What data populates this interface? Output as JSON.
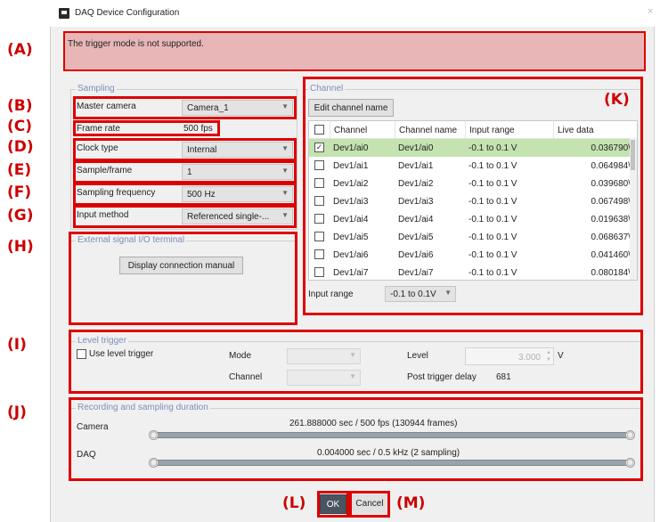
{
  "window": {
    "title": "DAQ Device Configuration",
    "close_glyph": "×"
  },
  "message": {
    "text": "The trigger mode is not supported."
  },
  "annotations": {
    "A": "(A)",
    "B": "(B)",
    "C": "(C)",
    "D": "(D)",
    "E": "(E)",
    "F": "(F)",
    "G": "(G)",
    "H": "(H)",
    "I": "(I)",
    "J": "(J)",
    "K": "(K)",
    "L": "(L)",
    "M": "(M)"
  },
  "sampling": {
    "group_title": "Sampling",
    "master_camera": {
      "label": "Master camera",
      "value": "Camera_1"
    },
    "frame_rate": {
      "label": "Frame rate",
      "value": "500 fps"
    },
    "clock_type": {
      "label": "Clock type",
      "value": "Internal"
    },
    "sample_frame": {
      "label": "Sample/frame",
      "value": "1"
    },
    "sampling_frequency": {
      "label": "Sampling frequency",
      "value": "500 Hz"
    },
    "input_method": {
      "label": "Input method",
      "value": "Referenced single-..."
    }
  },
  "external": {
    "group_title": "External signal I/O terminal",
    "button_label": "Display connection manual"
  },
  "channel": {
    "group_title": "Channel",
    "edit_button": "Edit channel name",
    "headers": [
      "Channel",
      "Channel name",
      "Input range",
      "Live data"
    ],
    "rows": [
      {
        "checked": true,
        "channel": "Dev1/ai0",
        "name": "Dev1/ai0",
        "range": "-0.1 to 0.1 V",
        "live": "0.036790\\"
      },
      {
        "checked": false,
        "channel": "Dev1/ai1",
        "name": "Dev1/ai1",
        "range": "-0.1 to 0.1 V",
        "live": "0.064984\\"
      },
      {
        "checked": false,
        "channel": "Dev1/ai2",
        "name": "Dev1/ai2",
        "range": "-0.1 to 0.1 V",
        "live": "0.039680\\"
      },
      {
        "checked": false,
        "channel": "Dev1/ai3",
        "name": "Dev1/ai3",
        "range": "-0.1 to 0.1 V",
        "live": "0.067498\\"
      },
      {
        "checked": false,
        "channel": "Dev1/ai4",
        "name": "Dev1/ai4",
        "range": "-0.1 to 0.1 V",
        "live": "0.019638\\"
      },
      {
        "checked": false,
        "channel": "Dev1/ai5",
        "name": "Dev1/ai5",
        "range": "-0.1 to 0.1 V",
        "live": "0.068637\\"
      },
      {
        "checked": false,
        "channel": "Dev1/ai6",
        "name": "Dev1/ai6",
        "range": "-0.1 to 0.1 V",
        "live": "0.041460\\"
      },
      {
        "checked": false,
        "channel": "Dev1/ai7",
        "name": "Dev1/ai7",
        "range": "-0.1 to 0.1 V",
        "live": "0.080184\\"
      }
    ],
    "input_range_label": "Input range",
    "input_range_value": "-0.1 to 0.1V"
  },
  "level_trigger": {
    "group_title": "Level trigger",
    "use_label": "Use level trigger",
    "mode_label": "Mode",
    "channel_label": "Channel",
    "level_label": "Level",
    "level_value": "3.000",
    "level_unit": "V",
    "post_delay_label": "Post trigger delay",
    "post_delay_value": "681"
  },
  "duration": {
    "group_title": "Recording and sampling duration",
    "camera_label": "Camera",
    "camera_text": "261.888000 sec / 500 fps (130944 frames)",
    "daq_label": "DAQ",
    "daq_text": "0.004000 sec / 0.5 kHz (2 sampling)"
  },
  "footer": {
    "ok_label": "OK",
    "cancel_label": "Cancel"
  }
}
